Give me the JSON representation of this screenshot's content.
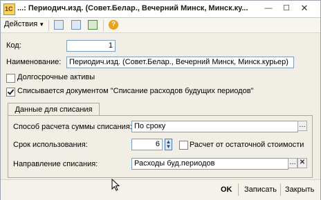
{
  "window": {
    "title": "...: Периодич.изд. (Совет.Белар., Вечерний Минск, Минск.ку...",
    "app_icon": "1С"
  },
  "toolbar": {
    "actions_label": "Действия",
    "icons": [
      "save-form-icon",
      "refresh-icon",
      "copy-new-icon",
      "help-icon"
    ]
  },
  "form": {
    "code_label": "Код:",
    "code_value": "1",
    "name_label": "Наименование:",
    "name_value": "Периодич.изд. (Совет.Белар., Вечерний Минск, Минск.курьер)",
    "long_term_assets_label": "Долгосрочные активы",
    "long_term_assets_checked": false,
    "writeoff_doc_label": "Списывается документом \"Списание расходов будущих периодов\"",
    "writeoff_doc_checked": true
  },
  "tabs": [
    {
      "label": "Данные для списания"
    }
  ],
  "writeoff": {
    "method_label": "Способ расчета суммы списания:",
    "method_value": "По сроку",
    "period_label": "Срок использования:",
    "period_value": "6",
    "residual_label": "Расчет от остаточной стоимости",
    "residual_checked": false,
    "direction_label": "Направление списания:",
    "direction_value": "Расходы буд.периодов"
  },
  "footer": {
    "ok_label": "OK",
    "save_label": "Записать",
    "close_label": "Закрыть"
  }
}
